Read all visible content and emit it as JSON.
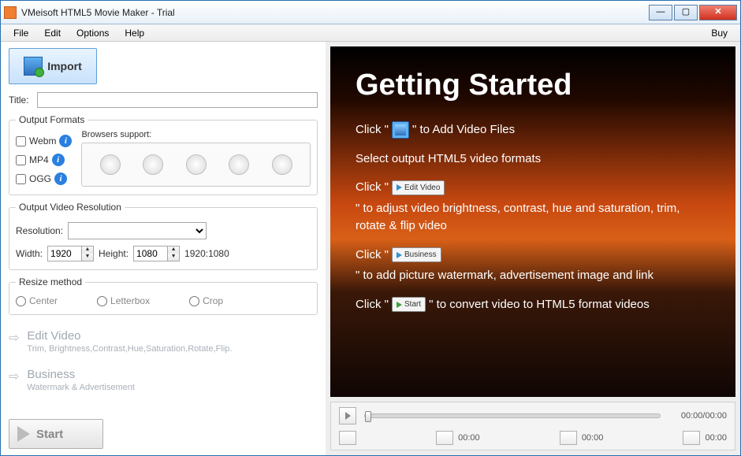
{
  "window": {
    "title": "VMeisoft HTML5 Movie Maker - Trial"
  },
  "menu": {
    "file": "File",
    "edit": "Edit",
    "options": "Options",
    "help": "Help",
    "buy": "Buy"
  },
  "left": {
    "import": "Import",
    "title_label": "Title:",
    "title_value": "",
    "formats": {
      "legend": "Output Formats",
      "webm": "Webm",
      "mp4": "MP4",
      "ogg": "OGG",
      "browsers_label": "Browsers support:"
    },
    "resolution": {
      "legend": "Output Video Resolution",
      "label": "Resolution:",
      "width_label": "Width:",
      "width_value": "1920",
      "height_label": "Height:",
      "height_value": "1080",
      "display": "1920:1080"
    },
    "resize": {
      "legend": "Resize method",
      "center": "Center",
      "letterbox": "Letterbox",
      "crop": "Crop"
    },
    "editvideo": {
      "title": "Edit Video",
      "desc": "Trim, Brightness,Contrast,Hue,Saturation,Rotate,Flip."
    },
    "business": {
      "title": "Business",
      "desc": "Watermark & Advertisement"
    },
    "start": "Start"
  },
  "preview": {
    "heading": "Getting Started",
    "l1a": "Click \"",
    "l1b": "\" to Add Video Files",
    "l2": "Select output HTML5 video formats",
    "l3a": "Click \"",
    "chip_edit": "Edit Video",
    "l3b": "\" to adjust video brightness, contrast, hue and saturation, trim, rotate & flip video",
    "l4a": "Click \"",
    "chip_business": "Business",
    "l4b": "\" to add picture watermark, advertisement image and link",
    "l5a": "Click \"",
    "chip_start": "Start",
    "l5b": "\" to convert video to HTML5 format videos"
  },
  "player": {
    "timecode": "00:00/00:00",
    "t1": "00:00",
    "t2": "00:00",
    "t3": "00:00"
  }
}
